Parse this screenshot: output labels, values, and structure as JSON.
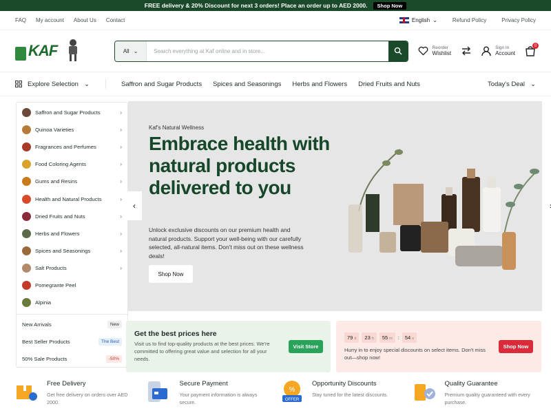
{
  "promo_bar": {
    "text": "FREE delivery & 20% Discount for next 3 orders! Place an order up to AED 2000.",
    "cta": "Shop Now"
  },
  "topbar": {
    "links": [
      "FAQ",
      "My account",
      "About Us",
      "Contact"
    ],
    "language": "English",
    "refund": "Refund Policy",
    "privacy": "Privacy Policy"
  },
  "header": {
    "logo_text": "KAF",
    "search": {
      "category": "All",
      "placeholder": "Search everything at Kaf online and in store..."
    },
    "reorder": {
      "small": "Reorder",
      "big": "Wishlist"
    },
    "account": {
      "small": "Sign In",
      "big": "Account"
    },
    "cart_count": "0"
  },
  "catnav": {
    "explore": "Explore Selection",
    "links": [
      "Saffron and Sugar Products",
      "Spices and Seasonings",
      "Herbs and Flowers",
      "Dried Fruits and Nuts"
    ],
    "deal": "Today's Deal"
  },
  "sidebar": {
    "items": [
      {
        "label": "Saffron and Sugar Products",
        "color": "#6b4a3a",
        "arrow": true
      },
      {
        "label": "Quinoa Varieties",
        "color": "#b87c3a",
        "arrow": true
      },
      {
        "label": "Fragrances and Perfumes",
        "color": "#a83a2a",
        "arrow": true
      },
      {
        "label": "Food Coloring Agents",
        "color": "#d9a32a",
        "arrow": true
      },
      {
        "label": "Gums and Resins",
        "color": "#c97a1a",
        "arrow": true
      },
      {
        "label": "Health and Natural Products",
        "color": "#d94a2a",
        "arrow": true
      },
      {
        "label": "Dried Fruits and Nuts",
        "color": "#8a2a3a",
        "arrow": true
      },
      {
        "label": "Herbs and Flowers",
        "color": "#5a6a4a",
        "arrow": true
      },
      {
        "label": "Spices and Seasonings",
        "color": "#9a6a3a",
        "arrow": true
      },
      {
        "label": "Salt Products",
        "color": "#b08a6a",
        "arrow": true
      },
      {
        "label": "Pomegrante Peel",
        "color": "#c23a2a",
        "arrow": false
      },
      {
        "label": "Alpinia",
        "color": "#6a7a3a",
        "arrow": false
      }
    ],
    "extras": [
      {
        "label": "New Arrivals",
        "tag": "New"
      },
      {
        "label": "Best Seller Products",
        "tag": "The Best"
      },
      {
        "label": "50% Sale Products",
        "tag": "-50%"
      }
    ]
  },
  "hero": {
    "eyebrow": "Kaf's Natural Wellness",
    "title": "Embrace health with natural products delivered to you",
    "desc": "Unlock exclusive discounts on our premium health and natural products. Support your well-being with our carefully selected, all-natural items. Don't miss out on these wellness deals!",
    "cta": "Shop Now"
  },
  "promo_left": {
    "title": "Get the best prices here",
    "desc": "Visit us to find top-quality products at the best prices. We're committed to offering great value and selection for all your needs.",
    "cta": "Visit Store"
  },
  "promo_right": {
    "timer": {
      "d": "79",
      "h": "23",
      "m": "55",
      "s": "54",
      "du": "d",
      "hu": "h",
      "mu": "m",
      "su": "s"
    },
    "desc": "Hurry in to enjoy special discounts on select items. Don't miss out—shop now!",
    "cta": "Shop Now"
  },
  "features": [
    {
      "title": "Free Delivery",
      "desc": "Get free delivery on orders over AED 2000."
    },
    {
      "title": "Secure Payment",
      "desc": "Your payment information is always secure."
    },
    {
      "title": "Opportunity Discounts",
      "desc": "Stay tuned for the latest discounts."
    },
    {
      "title": "Quality Guarantee",
      "desc": "Premium quality guaranteed with every purchase."
    }
  ]
}
